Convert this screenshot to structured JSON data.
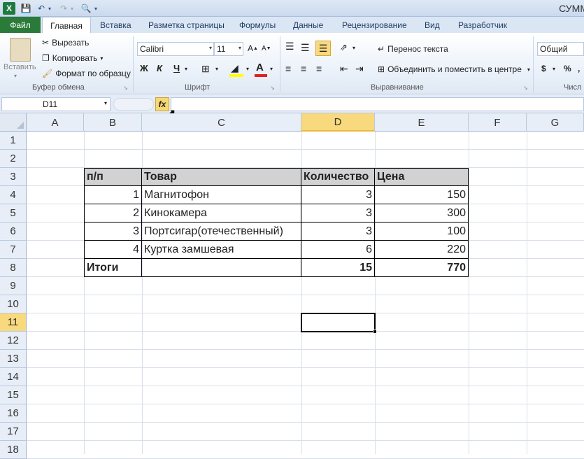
{
  "title_bar": {
    "app_icon": "X",
    "title": "СУММ"
  },
  "ribbon_tabs": [
    "Файл",
    "Главная",
    "Вставка",
    "Разметка страницы",
    "Формулы",
    "Данные",
    "Рецензирование",
    "Вид",
    "Разработчик"
  ],
  "clipboard": {
    "paste": "Вставить",
    "cut": "Вырезать",
    "copy": "Копировать",
    "format_painter": "Формат по образцу",
    "group": "Буфер обмена"
  },
  "font": {
    "name": "Calibri",
    "size": "11",
    "bold": "Ж",
    "italic": "К",
    "underline": "Ч",
    "group": "Шрифт"
  },
  "alignment": {
    "wrap": "Перенос текста",
    "merge": "Объединить и поместить в центре",
    "group": "Выравнивание"
  },
  "number": {
    "format": "Общий",
    "currency": "$",
    "percent": "%",
    "group": "Числ"
  },
  "formula_bar": {
    "name_box": "D11",
    "fx": "fx"
  },
  "columns": [
    "A",
    "B",
    "C",
    "D",
    "E",
    "F",
    "G"
  ],
  "rows": [
    "1",
    "2",
    "3",
    "4",
    "5",
    "6",
    "7",
    "8",
    "9",
    "10",
    "11",
    "12",
    "13",
    "14",
    "15",
    "16",
    "17",
    "18"
  ],
  "table": {
    "headers": [
      "п/п",
      "Товар",
      "Количество",
      "Цена"
    ],
    "rows": [
      [
        "1",
        "Магнитофон",
        "3",
        "150"
      ],
      [
        "2",
        "Кинокамера",
        "3",
        "300"
      ],
      [
        "3",
        "Портсигар(отечественный)",
        "3",
        "100"
      ],
      [
        "4",
        "Куртка замшевая",
        "6",
        "220"
      ]
    ],
    "totals": [
      "Итоги",
      "",
      "15",
      "770"
    ]
  },
  "colors": {
    "file_tab": "#2a7a3a",
    "selected_header": "#f9d97e",
    "table_header": "#d2d2d2"
  }
}
